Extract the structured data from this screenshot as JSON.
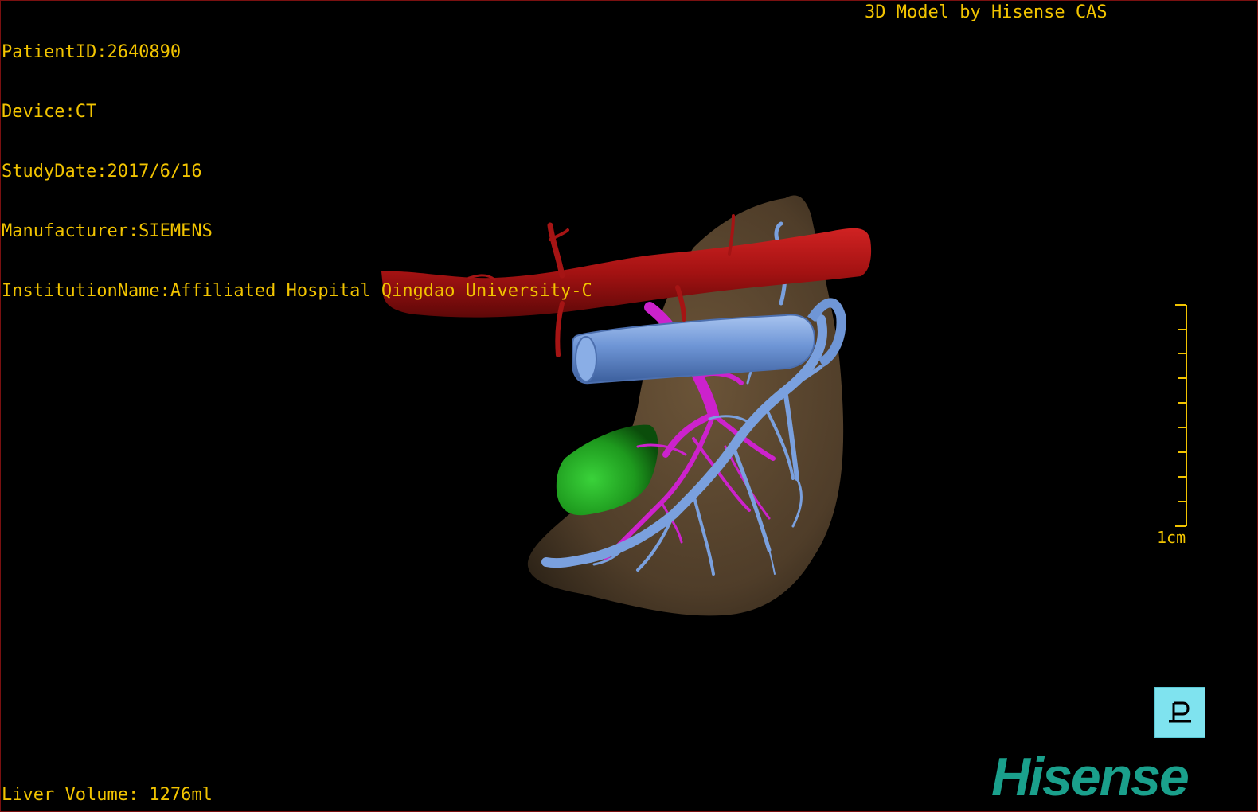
{
  "info": {
    "patient_id": "PatientID:2640890",
    "device": "Device:CT",
    "study_date": "StudyDate:2017/6/16",
    "manufacturer": "Manufacturer:SIEMENS",
    "institution": "InstitutionName:Affiliated Hospital Qingdao University-C"
  },
  "credit": "3D Model by Hisense CAS",
  "liver_volume": "Liver Volume: 1276ml",
  "scale": {
    "label": "1cm"
  },
  "view_button": {
    "icon": "orientation-P-icon"
  },
  "logo": "Hisense",
  "colors": {
    "text": "#f2c400",
    "artery_red": "#b51414",
    "portal_magenta": "#cc22cc",
    "vein_blue": "#6f96d6",
    "gallbladder_green": "#1e9a1e",
    "liver_brown": "#5e4a33",
    "logo_teal": "#1aa08c",
    "button_cyan": "#7fe3ef"
  }
}
